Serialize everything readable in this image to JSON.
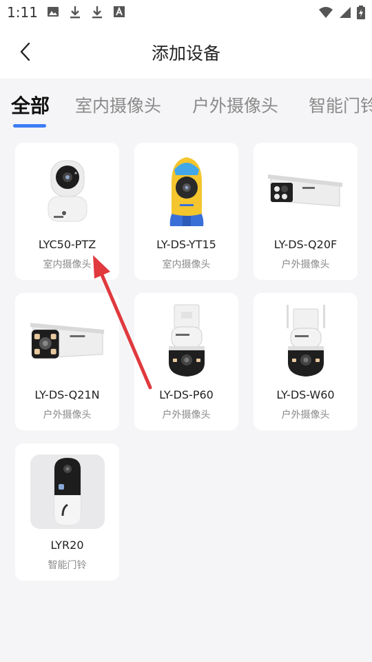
{
  "status_bar": {
    "time": "1:11",
    "left_icons": [
      "image-icon",
      "download-icon",
      "download-icon",
      "font-icon"
    ],
    "right_icons": [
      "wifi-icon",
      "signal-icon",
      "battery-charging-icon"
    ]
  },
  "header": {
    "title": "添加设备",
    "back_icon": "chevron-left-icon"
  },
  "tabs": [
    {
      "label": "全部",
      "active": true
    },
    {
      "label": "室内摄像头",
      "active": false
    },
    {
      "label": "户外摄像头",
      "active": false
    },
    {
      "label": "智能门铃",
      "active": false
    }
  ],
  "devices": [
    {
      "name": "LYC50-PTZ",
      "category": "室内摄像头",
      "image": "indoor-ptz-camera"
    },
    {
      "name": "LY-DS-YT15",
      "category": "室内摄像头",
      "image": "rocket-camera"
    },
    {
      "name": "LY-DS-Q20F",
      "category": "户外摄像头",
      "image": "bullet-camera"
    },
    {
      "name": "LY-DS-Q21N",
      "category": "户外摄像头",
      "image": "bullet-camera-large"
    },
    {
      "name": "LY-DS-P60",
      "category": "户外摄像头",
      "image": "dome-ptz-camera"
    },
    {
      "name": "LY-DS-W60",
      "category": "户外摄像头",
      "image": "dome-ptz-camera-antenna"
    },
    {
      "name": "LYR20",
      "category": "智能门铃",
      "image": "video-doorbell"
    }
  ],
  "colors": {
    "accent": "#3d7cf6",
    "annotation_arrow": "#e0393e",
    "background": "#f5f5f7"
  }
}
